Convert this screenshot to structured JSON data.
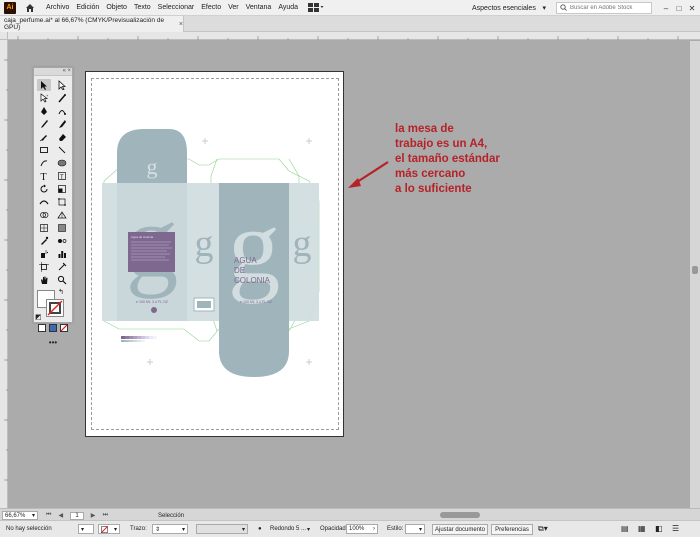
{
  "menu": {
    "app_logo": "Ai",
    "items": [
      "Archivo",
      "Edición",
      "Objeto",
      "Texto",
      "Seleccionar",
      "Efecto",
      "Ver",
      "Ventana",
      "Ayuda"
    ],
    "workspace": "Aspectos esenciales",
    "search_placeholder": "Buscar en Adobe Stock",
    "window_buttons": [
      "–",
      "□",
      "✕"
    ]
  },
  "document_tab": {
    "title": "caja_perfume.ai* al 66,67% (CMYK/Previsualización de GPU)",
    "close": "×"
  },
  "artwork": {
    "big_letter": "g",
    "product_name": [
      "AGUA",
      "DE",
      "COLONIA"
    ],
    "volume_label": "e 100 ML 3.4 FL OZ",
    "label_box_heading": "Agua de Colonia"
  },
  "annotation": {
    "lines": [
      "la mesa de",
      "trabajo es un A4,",
      "el tamaño estándar",
      "más cercano",
      "a lo suficiente"
    ],
    "color": "#b52228"
  },
  "status_bar": {
    "zoom": "66,67%",
    "artboard_number": "1",
    "tool_status": "Selección"
  },
  "control_bar": {
    "selection_status": "No hay selección",
    "stroke_label": "Trazo:",
    "brush": "Redondo 5 ...",
    "opacity_label": "Opacidad:",
    "opacity_value": "100%",
    "style_label": "Estilo:",
    "document_setup_button": "Ajustar documento",
    "preferences_button": "Preferencias"
  },
  "colors": {
    "box_gray_blue": "#9fb4bb",
    "box_light": "#d2dde0",
    "label_purple": "#7e6890",
    "accent_red": "#b52228"
  }
}
